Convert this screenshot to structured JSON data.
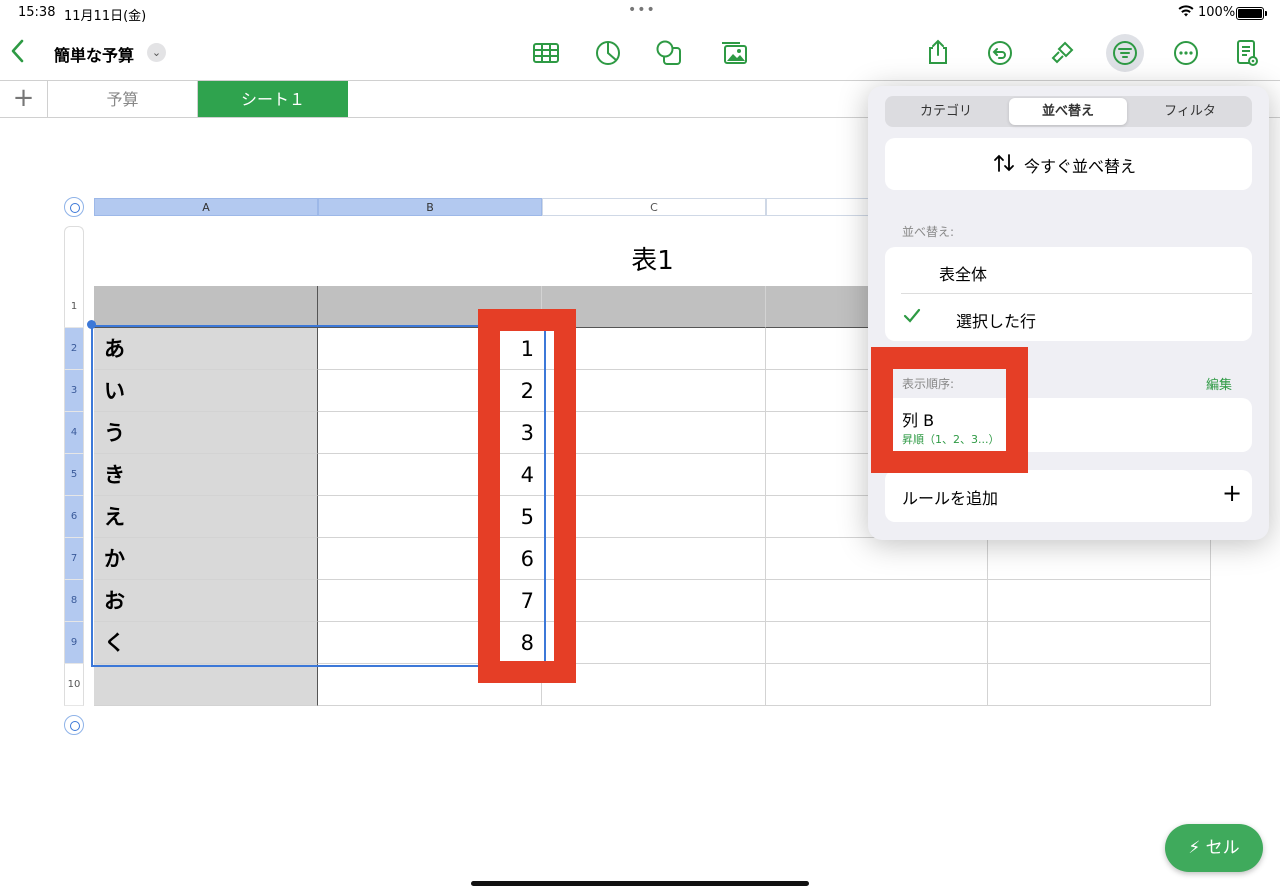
{
  "status": {
    "time": "15:38",
    "date": "11月11日(金)",
    "battery": "100%"
  },
  "toolbar": {
    "doc_title": "簡単な予算",
    "icons": [
      "back-icon",
      "table-icon",
      "chart-icon",
      "shape-icon",
      "media-icon",
      "share-icon",
      "undo-icon",
      "brush-icon",
      "sort-filter-icon",
      "more-icon",
      "view-icon"
    ]
  },
  "tabs": {
    "add": "+",
    "items": [
      "予算",
      "シート１"
    ]
  },
  "sheet": {
    "columns": [
      "A",
      "B",
      "C"
    ],
    "rows": [
      "1",
      "2",
      "3",
      "4",
      "5",
      "6",
      "7",
      "8",
      "9",
      "10"
    ],
    "table_title": "表1",
    "kana": [
      "あ",
      "い",
      "う",
      "き",
      "え",
      "か",
      "お",
      "く"
    ],
    "values": [
      "1",
      "2",
      "3",
      "4",
      "5",
      "6",
      "7",
      "8"
    ]
  },
  "popover": {
    "tabs": [
      "カテゴリ",
      "並べ替え",
      "フィルタ"
    ],
    "sort_now": "今すぐ並べ替え",
    "sort_label": "並べ替え:",
    "scope_whole": "表全体",
    "scope_selected": "選択した行",
    "order_label": "表示順序:",
    "edit": "編集",
    "rule_column": "列 B",
    "rule_order": "昇順（1、2、3...）",
    "add_rule": "ルールを追加",
    "add_plus": "+"
  },
  "fab": {
    "label": "セル"
  },
  "colors": {
    "accent": "#2e9a44",
    "highlight": "#e53e26",
    "selection": "#3c78d8"
  }
}
